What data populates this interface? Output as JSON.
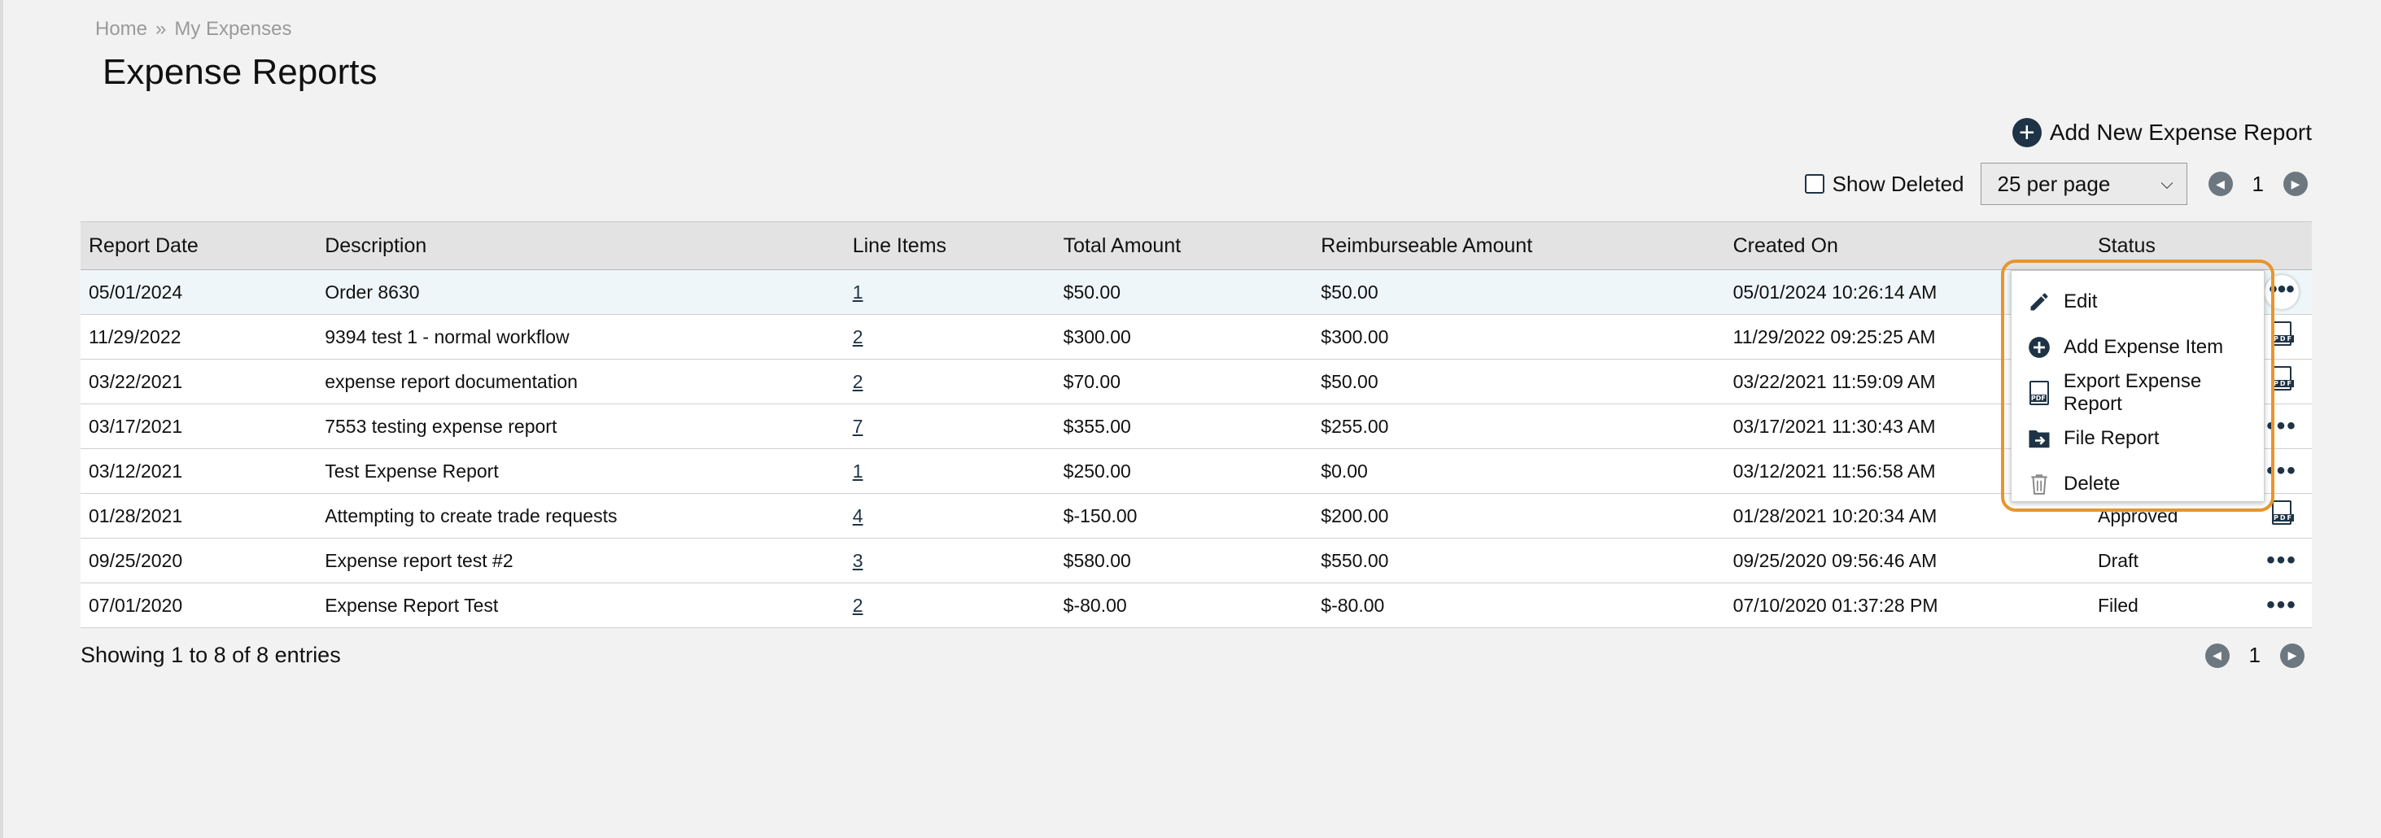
{
  "breadcrumb": {
    "home": "Home",
    "separator": "»",
    "current": "My Expenses"
  },
  "page": {
    "title": "Expense Reports"
  },
  "toolbar": {
    "add_new_label": "Add New Expense Report",
    "show_deleted_label": "Show Deleted",
    "per_page": "25 per page",
    "page_number": "1"
  },
  "table": {
    "headers": [
      "Report Date",
      "Description",
      "Line Items",
      "Total Amount",
      "Reimburseable Amount",
      "Created On",
      "Status"
    ],
    "rows": [
      {
        "date": "05/01/2024",
        "description": "Order 8630",
        "line_items": "1",
        "total": "$50.00",
        "reimbursable": "$50.00",
        "created": "05/01/2024 10:26:14 AM",
        "status": ""
      },
      {
        "date": "11/29/2022",
        "description": "9394 test 1 - normal workflow",
        "line_items": "2",
        "total": "$300.00",
        "reimbursable": "$300.00",
        "created": "11/29/2022 09:25:25 AM",
        "status": ""
      },
      {
        "date": "03/22/2021",
        "description": "expense report documentation",
        "line_items": "2",
        "total": "$70.00",
        "reimbursable": "$50.00",
        "created": "03/22/2021 11:59:09 AM",
        "status": ""
      },
      {
        "date": "03/17/2021",
        "description": "7553 testing expense report",
        "line_items": "7",
        "total": "$355.00",
        "reimbursable": "$255.00",
        "created": "03/17/2021 11:30:43 AM",
        "status": ""
      },
      {
        "date": "03/12/2021",
        "description": "Test Expense Report",
        "line_items": "1",
        "total": "$250.00",
        "reimbursable": "$0.00",
        "created": "03/12/2021 11:56:58 AM",
        "status": ""
      },
      {
        "date": "01/28/2021",
        "description": "Attempting to create trade requests",
        "line_items": "4",
        "total": "$-150.00",
        "reimbursable": "$200.00",
        "created": "01/28/2021 10:20:34 AM",
        "status": "Approved"
      },
      {
        "date": "09/25/2020",
        "description": "Expense report test #2",
        "line_items": "3",
        "total": "$580.00",
        "reimbursable": "$550.00",
        "created": "09/25/2020 09:56:46 AM",
        "status": "Draft"
      },
      {
        "date": "07/01/2020",
        "description": "Expense Report Test",
        "line_items": "2",
        "total": "$-80.00",
        "reimbursable": "$-80.00",
        "created": "07/10/2020 01:37:28 PM",
        "status": "Filed"
      }
    ],
    "row_actions": [
      "more-options-icon",
      "pdf-icon",
      "pdf-icon",
      "more-options-icon",
      "more-options-icon",
      "pdf-icon",
      "more-options-icon",
      "more-options-icon"
    ]
  },
  "context_menu": {
    "items": [
      {
        "label": "Edit",
        "icon": "pencil-icon"
      },
      {
        "label": "Add Expense Item",
        "icon": "plus-circle-icon"
      },
      {
        "label": "Export Expense Report",
        "icon": "pdf-icon"
      },
      {
        "label": "File Report",
        "icon": "file-submit-icon"
      },
      {
        "label": "Delete",
        "icon": "trash-icon"
      }
    ]
  },
  "footer": {
    "info": "Showing 1 to 8 of 8 entries",
    "page_number": "1"
  },
  "colors": {
    "accent_dark": "#1f3346",
    "highlight_outline": "#e8952c",
    "selected_row": "#eef6f9",
    "pager_button": "#6d7780"
  }
}
